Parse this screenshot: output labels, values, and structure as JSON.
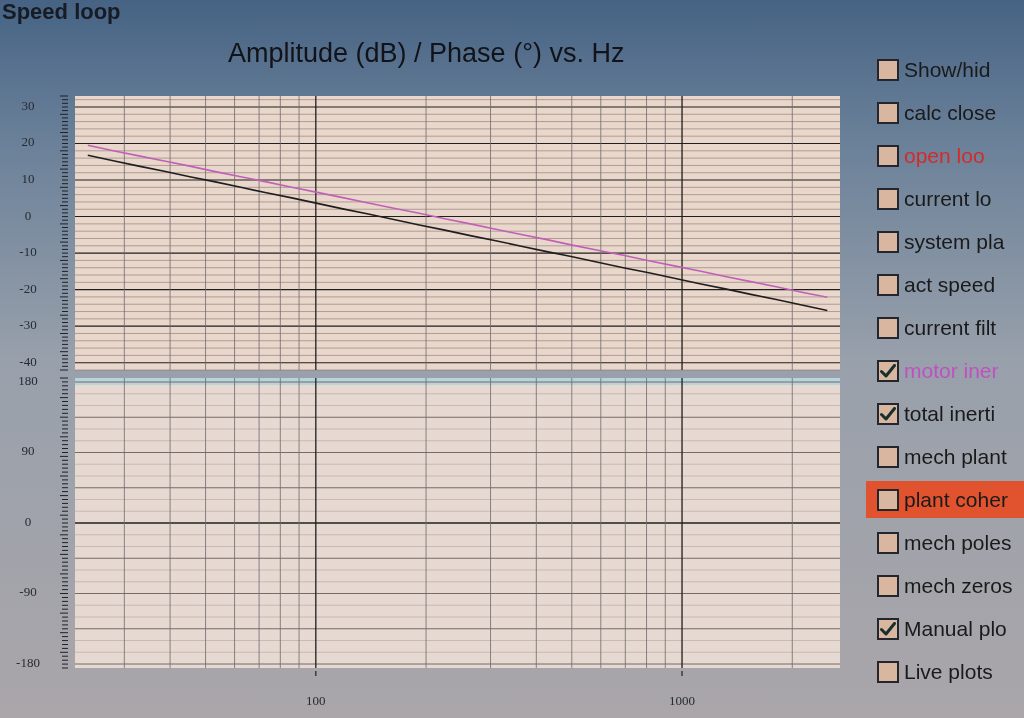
{
  "panel_title": "Speed loop",
  "plot": {
    "title": "Amplitude (dB) / Phase (°) vs. Hz",
    "amplitude": {
      "chart_data": {
        "type": "line",
        "categories": [
          null,
          null,
          null,
          null,
          null,
          null,
          null,
          null,
          null,
          null,
          null,
          null,
          null,
          null,
          null,
          null,
          null,
          null,
          null,
          null,
          null,
          null,
          null,
          null,
          null,
          null,
          null,
          null,
          null,
          null
        ],
        "ylim": [
          -42,
          33
        ],
        "yticks": [
          30,
          20,
          10,
          0,
          -10,
          -20,
          -30,
          -40
        ],
        "grid": true,
        "series": [
          {
            "color": "#c060b8",
            "values": [
              19.5,
              18.0,
              16.6,
              15.2,
              13.8,
              12.3,
              10.9,
              9.5,
              8.0,
              6.6,
              5.2,
              3.7,
              2.3,
              0.9,
              -0.6,
              -2.0,
              -3.5,
              -4.9,
              -6.3,
              -7.8,
              -9.2,
              -10.6,
              -12.1,
              -13.5,
              -14.9,
              -16.4,
              -17.8,
              -19.2,
              -20.7,
              -22.1
            ]
          },
          {
            "color": "#1e1e1e",
            "values": [
              16.8,
              15.3,
              13.8,
              12.4,
              10.9,
              9.5,
              8.0,
              6.5,
              5.1,
              3.6,
              2.1,
              0.7,
              -0.8,
              -2.3,
              -3.7,
              -5.2,
              -6.6,
              -8.1,
              -9.6,
              -11.0,
              -12.5,
              -14.0,
              -15.4,
              -16.9,
              -18.4,
              -19.8,
              -21.3,
              -22.7,
              -24.2,
              -25.7
            ]
          }
        ]
      }
    },
    "phase": {
      "y_labels": [
        "180",
        "90",
        "0",
        "-90",
        "-180"
      ]
    },
    "frequency_labels": [
      "100",
      "1000"
    ]
  },
  "options": [
    {
      "label": "Show/hid",
      "checked": false,
      "selected": false,
      "color": "#1a1a1a"
    },
    {
      "label": "calc close",
      "checked": false,
      "selected": false,
      "color": "#1a1a1a"
    },
    {
      "label": "open loo",
      "checked": false,
      "selected": false,
      "color": "#d42a2a"
    },
    {
      "label": "current lo",
      "checked": false,
      "selected": false,
      "color": "#1a1a1a"
    },
    {
      "label": "system pla",
      "checked": false,
      "selected": false,
      "color": "#1a1a1a"
    },
    {
      "label": "act speed",
      "checked": false,
      "selected": false,
      "color": "#1a1a1a"
    },
    {
      "label": "current filt",
      "checked": false,
      "selected": false,
      "color": "#1a1a1a"
    },
    {
      "label": "motor iner",
      "checked": true,
      "selected": false,
      "color": "#c050c0"
    },
    {
      "label": "total inerti",
      "checked": true,
      "selected": false,
      "color": "#1a1a1a"
    },
    {
      "label": "mech plant",
      "checked": false,
      "selected": false,
      "color": "#1a1a1a"
    },
    {
      "label": "plant coher",
      "checked": false,
      "selected": true,
      "color": "#1a1a1a"
    },
    {
      "label": "mech poles",
      "checked": false,
      "selected": false,
      "color": "#1a1a1a"
    },
    {
      "label": "mech zeros",
      "checked": false,
      "selected": false,
      "color": "#1a1a1a"
    },
    {
      "label": "Manual plo",
      "checked": true,
      "selected": false,
      "color": "#1a1a1a"
    },
    {
      "label": "Live plots",
      "checked": false,
      "selected": false,
      "color": "#1a1a1a"
    }
  ]
}
